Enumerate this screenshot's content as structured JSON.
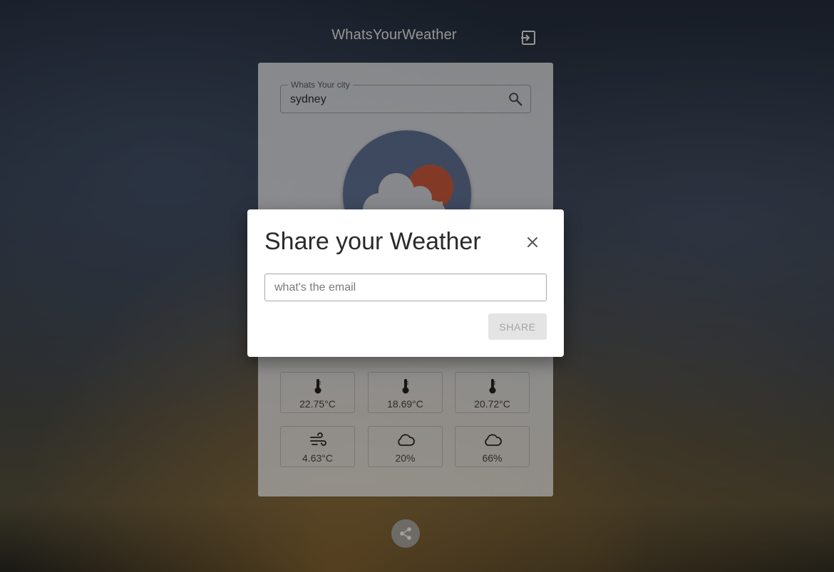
{
  "header": {
    "title": "WhatsYourWeather",
    "logout_icon": "logout-icon"
  },
  "search": {
    "label": "Whats Your city",
    "value": "sydney",
    "icon": "search-icon"
  },
  "weather": {
    "icon": "partly-cloudy-icon",
    "colors": {
      "circle": "#5c6d8e",
      "sun": "#d0532e",
      "cloud": "#d8d8d8"
    }
  },
  "tiles": [
    {
      "icon": "thermometer-icon",
      "value": "22.75°C"
    },
    {
      "icon": "thermometer-icon",
      "value": "18.69°C"
    },
    {
      "icon": "thermometer-icon",
      "value": "20.72°C"
    },
    {
      "icon": "wind-icon",
      "value": "4.63°C"
    },
    {
      "icon": "cloud-icon",
      "value": "20%"
    },
    {
      "icon": "cloud-icon",
      "value": "66%"
    }
  ],
  "fab": {
    "icon": "share-icon"
  },
  "modal": {
    "title": "Share your Weather",
    "email_placeholder": "what's the email",
    "share_label": "SHARE",
    "close_icon": "close-icon"
  }
}
